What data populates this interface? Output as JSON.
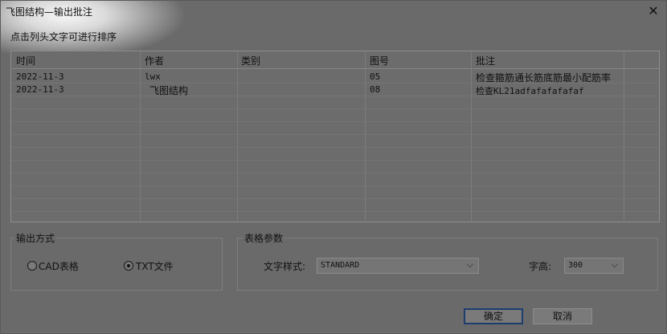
{
  "window": {
    "title": "飞图结构—输出批注"
  },
  "hint": "点击列头文字可进行排序",
  "table": {
    "columns": [
      "时间",
      "作者",
      "类别",
      "图号",
      "批注"
    ],
    "rows": [
      [
        "2022-11-3",
        "lwx",
        "",
        "05",
        "检查箍筋通长筋底筋最小配筋率"
      ],
      [
        "2022-11-3",
        "飞图结构",
        "",
        "08",
        "检查KL21adfafafafafaf"
      ]
    ]
  },
  "output_group": {
    "title": "输出方式",
    "options": [
      {
        "label": "CAD表格",
        "selected": false
      },
      {
        "label": "TXT文件",
        "selected": true
      }
    ]
  },
  "table_params_group": {
    "title": "表格参数",
    "text_style_label": "文字样式:",
    "text_style_value": "STANDARD",
    "font_height_label": "字高:",
    "font_height_value": "300"
  },
  "buttons": {
    "ok": "确定",
    "cancel": "取消"
  },
  "icons": {
    "close": "close-icon",
    "dropdown": "chevron-down-icon"
  }
}
